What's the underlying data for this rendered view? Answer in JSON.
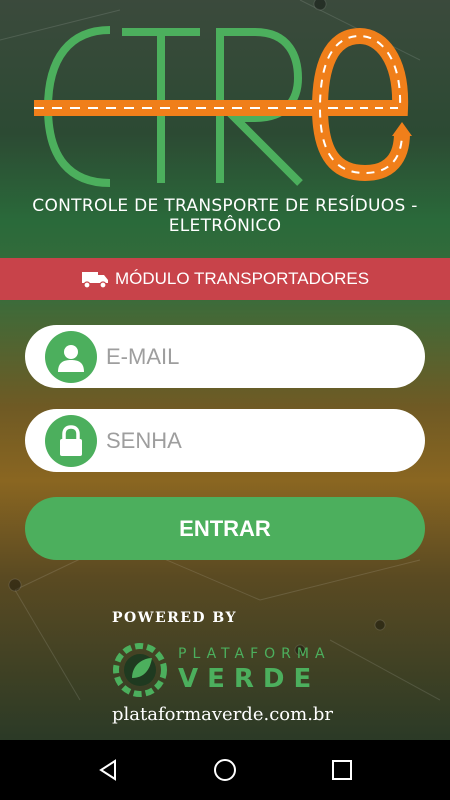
{
  "app": {
    "logo_text": "CTRe",
    "subtitle": "CONTROLE DE TRANSPORTE DE RESÍDUOS - ELETRÔNICO"
  },
  "module": {
    "label": "MÓDULO TRANSPORTADORES",
    "icon": "truck-icon"
  },
  "form": {
    "email_placeholder": "E-MAIL",
    "email_value": "",
    "email_icon": "user-icon",
    "password_placeholder": "SENHA",
    "password_value": "",
    "password_icon": "lock-icon",
    "submit_label": "ENTRAR"
  },
  "footer": {
    "powered_by": "POWERED BY",
    "brand_line1": "PLATAFORMA",
    "brand_line2": "VERDE",
    "url": "plataformaverde.com.br"
  },
  "navbar": {
    "back": "back-icon",
    "home": "home-icon",
    "recents": "recents-icon"
  },
  "colors": {
    "green": "#4caf5d",
    "orange": "#f07f1a",
    "red_bar": "#c8434a",
    "white": "#ffffff"
  }
}
